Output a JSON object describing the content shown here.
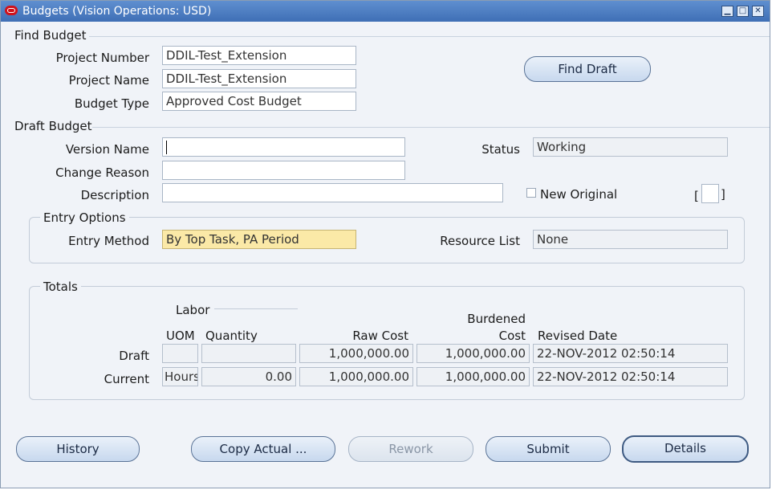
{
  "window": {
    "title": "Budgets (Vision Operations: USD)"
  },
  "find_budget": {
    "heading": "Find Budget",
    "project_number_label": "Project Number",
    "project_number_value": "DDIL-Test_Extension",
    "project_name_label": "Project Name",
    "project_name_value": "DDIL-Test_Extension",
    "budget_type_label": "Budget Type",
    "budget_type_value": "Approved Cost Budget",
    "find_draft_button": "Find Draft"
  },
  "draft_budget": {
    "heading": "Draft Budget",
    "version_name_label": "Version Name",
    "version_name_value": "",
    "change_reason_label": "Change Reason",
    "change_reason_value": "",
    "description_label": "Description",
    "description_value": "",
    "status_label": "Status",
    "status_value": "Working",
    "new_original_label": "New Original",
    "new_original_checked": false,
    "bracket_left": "[",
    "bracket_right": "]"
  },
  "entry_options": {
    "heading": "Entry Options",
    "entry_method_label": "Entry Method",
    "entry_method_value": "By Top Task, PA Period",
    "resource_list_label": "Resource List",
    "resource_list_value": "None"
  },
  "totals": {
    "heading": "Totals",
    "labor_heading": "Labor",
    "columns": {
      "uom": "UOM",
      "quantity": "Quantity",
      "raw_cost": "Raw Cost",
      "burdened_cost_line1": "Burdened",
      "burdened_cost_line2": "Cost",
      "revised_date": "Revised Date"
    },
    "rows": [
      {
        "label": "Draft",
        "uom": "",
        "quantity": "",
        "raw_cost": "1,000,000.00",
        "burdened_cost": "1,000,000.00",
        "revised_date": "22-NOV-2012 02:50:14"
      },
      {
        "label": "Current",
        "uom": "Hours",
        "quantity": "0.00",
        "raw_cost": "1,000,000.00",
        "burdened_cost": "1,000,000.00",
        "revised_date": "22-NOV-2012 02:50:14"
      }
    ]
  },
  "buttons": {
    "history": "History",
    "copy_actual": "Copy Actual ...",
    "rework": "Rework",
    "submit": "Submit",
    "details": "Details"
  },
  "colors": {
    "titlebar": "#4a7cc2",
    "required_field": "#fbe9a7",
    "window_bg": "#f0f3f8"
  }
}
